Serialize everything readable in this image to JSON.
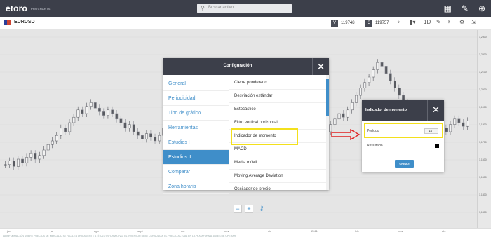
{
  "header": {
    "logo": "etoro",
    "logo_sub": "PROCHARTS",
    "search_placeholder": "Buscar activo",
    "icons": [
      "layout-icon",
      "pencil-icon",
      "crosshair-icon"
    ]
  },
  "toolbar": {
    "symbol": "EURUSD",
    "sell_tag": "V",
    "sell_price": "119748",
    "buy_tag": "C",
    "buy_price": "119757",
    "interval": "1D"
  },
  "chart_data": {
    "type": "candlestick",
    "series": [
      {
        "values": [
          0.32,
          0.34,
          0.31,
          0.35,
          0.33,
          0.36,
          0.38,
          0.35,
          0.37,
          0.4,
          0.43,
          0.45,
          0.48,
          0.52,
          0.5,
          0.55,
          0.58,
          0.62,
          0.6,
          0.64,
          0.66,
          0.63,
          0.61,
          0.59,
          0.62,
          0.6,
          0.57,
          0.55,
          0.52,
          0.54,
          0.5,
          0.48,
          0.46,
          0.49,
          0.47,
          0.45,
          0.48,
          0.52,
          0.55,
          0.53,
          0.57,
          0.6,
          0.64,
          0.68,
          0.72,
          0.75,
          0.79,
          0.82,
          0.78,
          0.74,
          0.71,
          0.66,
          0.62,
          0.6,
          0.58,
          0.62,
          0.65,
          0.63,
          0.58,
          0.55,
          0.52,
          0.5,
          0.47,
          0.44,
          0.4,
          0.38,
          0.35,
          0.3,
          0.28,
          0.32,
          0.36,
          0.4,
          0.44,
          0.42,
          0.46,
          0.5,
          0.54,
          0.57,
          0.6,
          0.58,
          0.62,
          0.66,
          0.7,
          0.74,
          0.77,
          0.8,
          0.84,
          0.88,
          0.86,
          0.82,
          0.78,
          0.74,
          0.7,
          0.66,
          0.62,
          0.6,
          0.56,
          0.52,
          0.5,
          0.47,
          0.45,
          0.48,
          0.52,
          0.5,
          0.54,
          0.57,
          0.55,
          0.53,
          0.56
        ]
      }
    ],
    "yaxis_labels": [
      "1,2300",
      "1,2200",
      "1,2100",
      "1,2000",
      "1,1900",
      "1,1800",
      "1,1700",
      "1,1600",
      "1,1500",
      "1,1400",
      "1,1300"
    ],
    "xaxis_labels": [
      "jun",
      "jul",
      "ago",
      "sept",
      "oct",
      "nov",
      "dic",
      "2021",
      "feb",
      "mar",
      "abr"
    ]
  },
  "footer": {
    "disclaimer": "LA INFORMACIÓN SOBRE PRECIOS DE MERCADO SE FACILITA ÚNICAMENTE A TÍTULO INFORMATIVO. EL INVERSOR DEBE CONSULTAR EL PRECIO ACTUAL EN LA PLATAFORMA ANTES DE OPERAR."
  },
  "dialog": {
    "title": "Configuración",
    "menu": [
      {
        "label": "General",
        "active": false
      },
      {
        "label": "Periodicidad",
        "active": false
      },
      {
        "label": "Tipo de gráfico",
        "active": false
      },
      {
        "label": "Herramientas",
        "active": false
      },
      {
        "label": "Estudios I",
        "active": false
      },
      {
        "label": "Estudios II",
        "active": true
      },
      {
        "label": "Comparar",
        "active": false
      },
      {
        "label": "Zona horaria",
        "active": false
      }
    ],
    "studies": [
      "Cierre ponderado",
      "Desviación estándar",
      "Estocástico",
      "Filtro vertical horizontal",
      "Indicador de momento",
      "MACD",
      "Media móvil",
      "Moving Average Deviation",
      "Oscilador de precio"
    ]
  },
  "zoom": {
    "minus": "−",
    "plus": "+"
  },
  "dialog2": {
    "title": "Indicador de momento",
    "period_label": "Período",
    "period_value": "14",
    "result_label": "Resultado",
    "result_color": "#000000",
    "create_label": "CREAR"
  },
  "highlight_color": "#f3e01c",
  "accent_color": "#3f8ec9",
  "arrow_color": "#e02020"
}
